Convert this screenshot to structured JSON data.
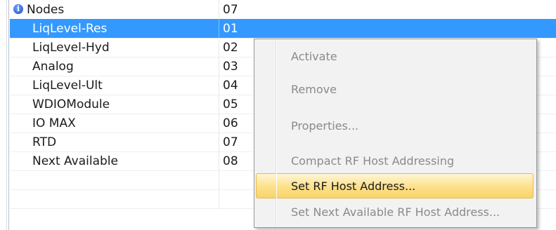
{
  "tree": {
    "header": {
      "label": "Nodes",
      "value": "07"
    },
    "rows": [
      {
        "label": "LiqLevel-Res",
        "value": "01",
        "selected": true
      },
      {
        "label": "LiqLevel-Hyd",
        "value": "02"
      },
      {
        "label": "Analog",
        "value": "03"
      },
      {
        "label": "LiqLevel-Ult",
        "value": "04"
      },
      {
        "label": "WDIOModule",
        "value": "05"
      },
      {
        "label": "IO MAX",
        "value": "06"
      },
      {
        "label": "RTD",
        "value": "07"
      },
      {
        "label": "Next Available",
        "value": "08"
      },
      {
        "label": "",
        "value": ""
      }
    ]
  },
  "context_menu": {
    "items": [
      {
        "label": "Activate",
        "enabled": false
      },
      {
        "label": "Remove",
        "enabled": false
      },
      {
        "label": "Properties...",
        "enabled": false
      },
      {
        "label": "Compact RF Host Addressing",
        "enabled": false
      },
      {
        "label": "Set RF Host Address...",
        "enabled": true,
        "highlighted": true
      },
      {
        "label": "Set Next Available RF Host Address...",
        "enabled": false
      }
    ]
  },
  "icons": {
    "header_icon": "info-icon"
  },
  "colors": {
    "selection": "#3399ff",
    "menu_highlight": "#fde08a"
  }
}
